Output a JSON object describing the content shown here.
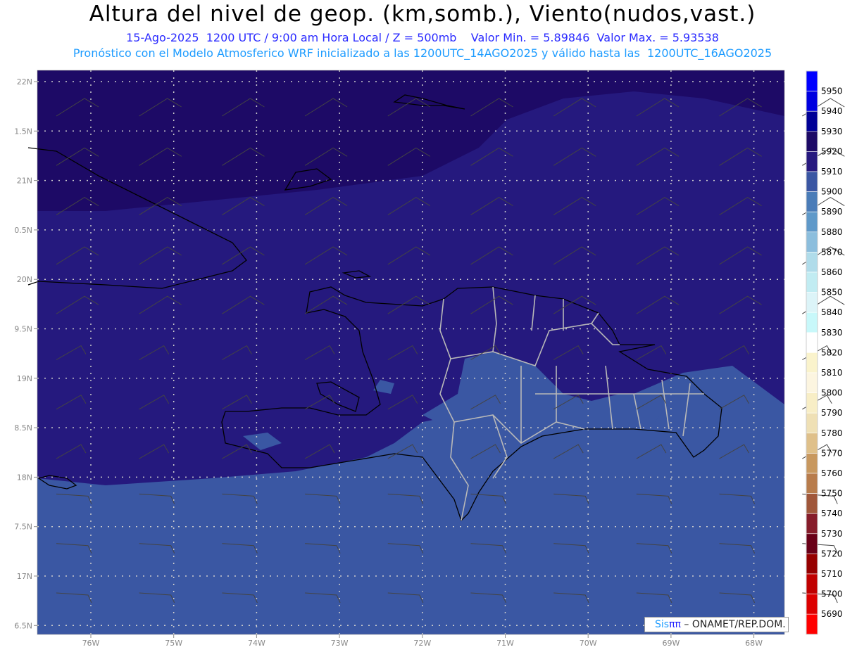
{
  "header": {
    "title": "Altura del nivel de geop. (km,somb.), Viento(nudos,vast.)",
    "subtitle": "15-Ago-2025  1200 UTC / 9:00 am Hora Local / Z = 500mb    Valor Min. = 5.89846  Valor Max. = 5.93538",
    "forecast_note": "Pronóstico con el Modelo Atmosferico WRF inicializado a las 1200UTC_14AGO2025 y válido hasta las  1200UTC_16AGO2025"
  },
  "map": {
    "lat_labels": [
      "22N",
      "1.5N",
      "21N",
      "0.5N",
      "20N",
      "9.5N",
      "19N",
      "8.5N",
      "18N",
      "7.5N",
      "17N",
      "6.5N"
    ],
    "lon_labels": [
      "76W",
      "75W",
      "74W",
      "73W",
      "72W",
      "71W",
      "70W",
      "69W",
      "68W"
    ],
    "fill_colors": {
      "high": "#1d0a66",
      "mid": "#25197e",
      "low": "#3a57a3"
    },
    "coast_color": "#000000",
    "province_color": "#b8b8b8",
    "barb_color": "#444444"
  },
  "colorbar": {
    "labels": [
      "5950",
      "5940",
      "5930",
      "5920",
      "5910",
      "5900",
      "5890",
      "5880",
      "5870",
      "5860",
      "5850",
      "5840",
      "5830",
      "5820",
      "5810",
      "5800",
      "5790",
      "5780",
      "5770",
      "5760",
      "5750",
      "5740",
      "5730",
      "5720",
      "5710",
      "5700",
      "5690"
    ],
    "colors": [
      "#0000ff",
      "#0000e0",
      "#000096",
      "#1d0a66",
      "#27197f",
      "#3a56a3",
      "#4a7cb8",
      "#5f99c9",
      "#8cbedd",
      "#b0dcea",
      "#c1ecf2",
      "#dcf4f8",
      "#c8f8fa",
      "#ffffff",
      "#faf3cc",
      "#fcf5e0",
      "#f8eec6",
      "#efe0b5",
      "#dfc08a",
      "#c8985f",
      "#b87c4c",
      "#a0573a",
      "#861c2a",
      "#6a0018",
      "#960000",
      "#c00000",
      "#dc0000",
      "#ff0000"
    ]
  },
  "credit": {
    "brand_a": "Sis",
    "brand_b": "ππ",
    "text": "– ONAMET/REP.DOM."
  }
}
